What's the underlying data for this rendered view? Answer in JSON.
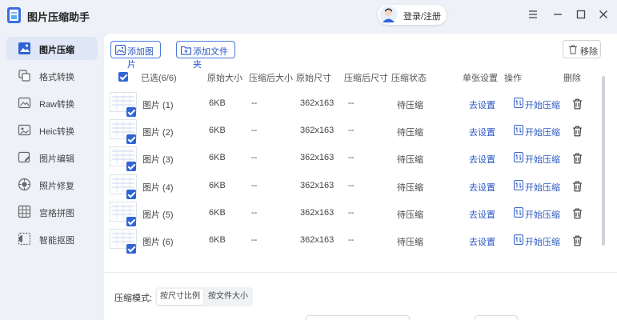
{
  "app": {
    "title": "图片压缩助手",
    "login_label": "登录/注册"
  },
  "sidebar": {
    "items": [
      {
        "label": "图片压缩",
        "icon": "image-compress-icon",
        "active": true
      },
      {
        "label": "格式转换",
        "icon": "format-convert-icon",
        "active": false
      },
      {
        "label": "Raw转换",
        "icon": "raw-convert-icon",
        "active": false
      },
      {
        "label": "Heic转换",
        "icon": "heic-convert-icon",
        "active": false
      },
      {
        "label": "图片编辑",
        "icon": "image-edit-icon",
        "active": false
      },
      {
        "label": "照片修复",
        "icon": "photo-repair-icon",
        "active": false
      },
      {
        "label": "宫格拼图",
        "icon": "grid-collage-icon",
        "active": false
      },
      {
        "label": "智能抠图",
        "icon": "smart-cutout-icon",
        "active": false
      }
    ]
  },
  "toolbar": {
    "add_image": "添加图片",
    "add_folder": "添加文件夹",
    "remove": "移除"
  },
  "table": {
    "headers": {
      "selected": "已选(6/6)",
      "original_size": "原始大小",
      "compressed_size": "压缩后大小",
      "original_dims": "原始尺寸",
      "compressed_dims": "压缩后尺寸",
      "status": "压缩状态",
      "single_settings": "单张设置",
      "action": "操作",
      "delete": "删除"
    },
    "rows": [
      {
        "name": "图片 (1)",
        "size": "6KB",
        "compressed_size": "--",
        "dims": "362x163",
        "compressed_dims": "--",
        "status": "待压缩",
        "settings": "去设置",
        "action": "开始压缩"
      },
      {
        "name": "图片 (2)",
        "size": "6KB",
        "compressed_size": "--",
        "dims": "362x163",
        "compressed_dims": "--",
        "status": "待压缩",
        "settings": "去设置",
        "action": "开始压缩"
      },
      {
        "name": "图片 (3)",
        "size": "6KB",
        "compressed_size": "--",
        "dims": "362x163",
        "compressed_dims": "--",
        "status": "待压缩",
        "settings": "去设置",
        "action": "开始压缩"
      },
      {
        "name": "图片 (4)",
        "size": "6KB",
        "compressed_size": "--",
        "dims": "362x163",
        "compressed_dims": "--",
        "status": "待压缩",
        "settings": "去设置",
        "action": "开始压缩"
      },
      {
        "name": "图片 (5)",
        "size": "6KB",
        "compressed_size": "--",
        "dims": "362x163",
        "compressed_dims": "--",
        "status": "待压缩",
        "settings": "去设置",
        "action": "开始压缩"
      },
      {
        "name": "图片 (6)",
        "size": "6KB",
        "compressed_size": "--",
        "dims": "362x163",
        "compressed_dims": "--",
        "status": "待压缩",
        "settings": "去设置",
        "action": "开始压缩"
      }
    ]
  },
  "compress_mode": {
    "label": "压缩模式:",
    "options": [
      "按尺寸比例",
      "按文件大小"
    ],
    "selected": "按尺寸比例"
  },
  "colors": {
    "accent": "#2e64d6",
    "link": "#2b58c4",
    "background": "#eef1f7"
  }
}
